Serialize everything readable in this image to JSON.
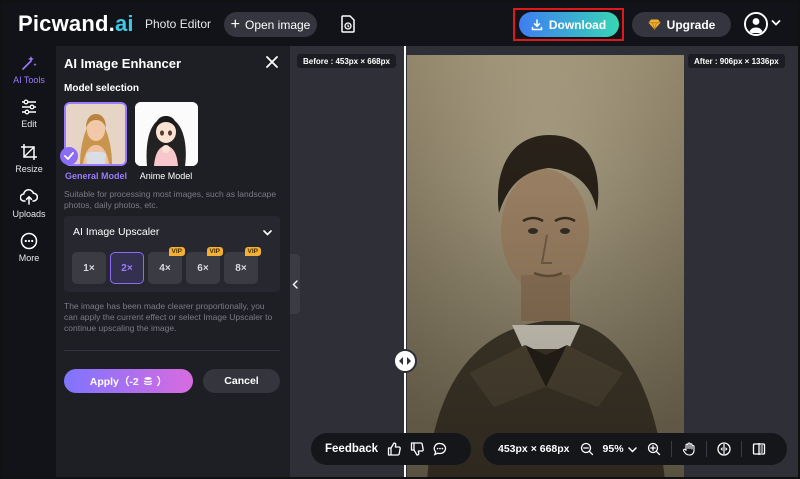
{
  "topbar": {
    "logo_main": "Picwand.",
    "logo_ai": "ai",
    "nav_photo_editor": "Photo Editor",
    "open_image_label": "Open image",
    "download_label": "Download",
    "upgrade_label": "Upgrade"
  },
  "rail": {
    "items": [
      {
        "label": "AI Tools",
        "icon": "ai-tools-icon",
        "active": true
      },
      {
        "label": "Edit",
        "icon": "sliders-icon"
      },
      {
        "label": "Resize",
        "icon": "crop-icon"
      },
      {
        "label": "Uploads",
        "icon": "upload-icon"
      },
      {
        "label": "More",
        "icon": "more-icon"
      }
    ]
  },
  "panel": {
    "title": "AI Image Enhancer",
    "model_selection_label": "Model selection",
    "models": [
      {
        "name": "General Model",
        "selected": true
      },
      {
        "name": "Anime Model",
        "selected": false
      }
    ],
    "model_description": "Suitable for processing most images, such as landscape photos, daily photos, etc.",
    "upscaler": {
      "title": "AI Image Upscaler",
      "scales": [
        {
          "label": "1×",
          "vip": false,
          "selected": false
        },
        {
          "label": "2×",
          "vip": false,
          "selected": true
        },
        {
          "label": "4×",
          "vip": true,
          "selected": false
        },
        {
          "label": "6×",
          "vip": true,
          "selected": false
        },
        {
          "label": "8×",
          "vip": true,
          "selected": false
        }
      ],
      "vip_badge": "VIP"
    },
    "note": "The image has been made clearer proportionally, you can apply the current effect or select Image Upscaler to continue upscaling the image.",
    "apply_label": "Apply（-2",
    "apply_suffix": "）",
    "cancel_label": "Cancel"
  },
  "canvas": {
    "before_tag": "Before : 453px × 668px",
    "after_tag": "After : 906px × 1336px",
    "feedback_label": "Feedback",
    "dimensions": "453px × 668px",
    "zoom": "95%"
  },
  "colors": {
    "accent": "#9b7bff",
    "download_gradient_start": "#3e7df2",
    "download_gradient_end": "#38d6b5",
    "highlight_box": "#e0181b",
    "vip": "#f2b134"
  }
}
